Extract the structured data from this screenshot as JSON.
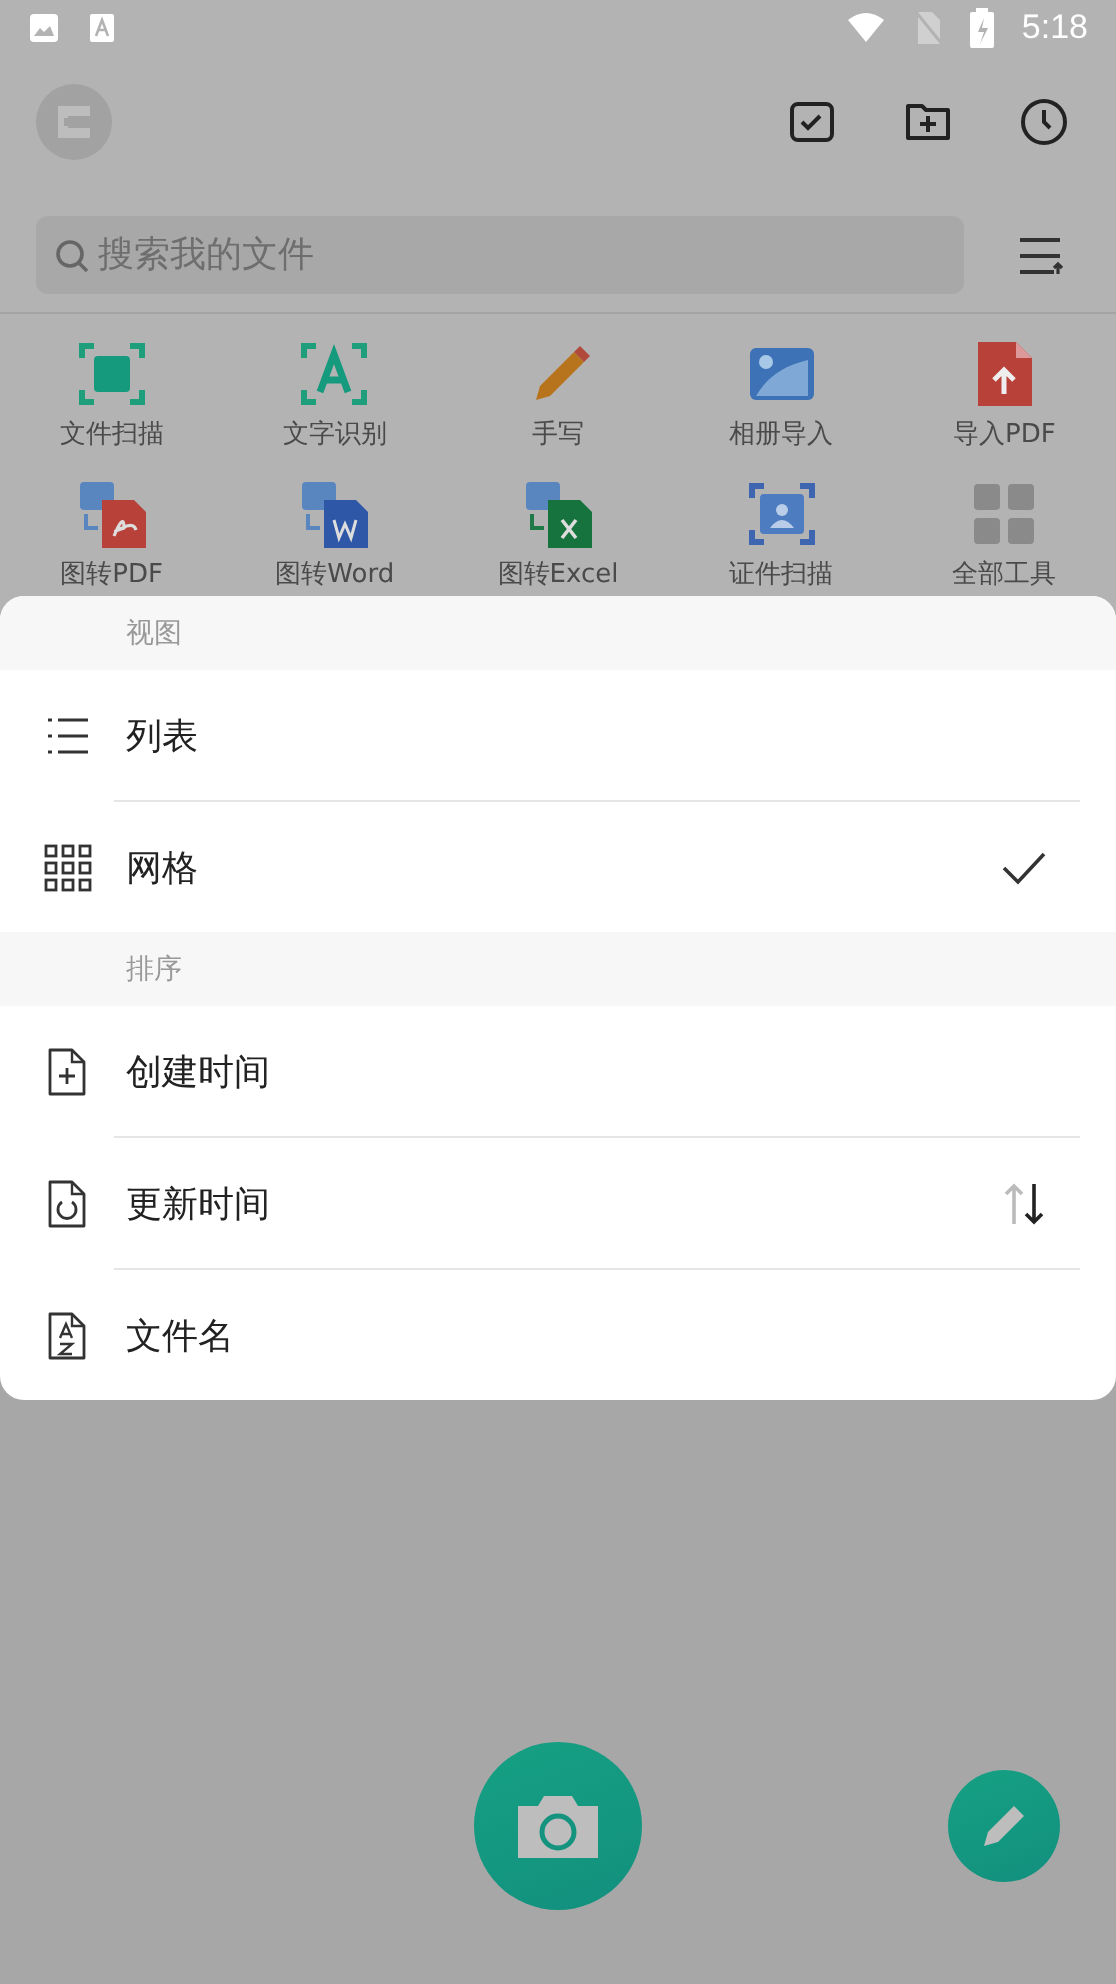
{
  "status_bar": {
    "time": "5:18"
  },
  "search": {
    "placeholder": "搜索我的文件"
  },
  "tools": [
    {
      "label": "文件扫描"
    },
    {
      "label": "文字识别"
    },
    {
      "label": "手写"
    },
    {
      "label": "相册导入"
    },
    {
      "label": "导入PDF"
    },
    {
      "label": "图转PDF"
    },
    {
      "label": "图转Word"
    },
    {
      "label": "图转Excel"
    },
    {
      "label": "证件扫描"
    },
    {
      "label": "全部工具"
    }
  ],
  "menu": {
    "view": {
      "title": "视图",
      "items": [
        {
          "label": "列表",
          "selected": false
        },
        {
          "label": "网格",
          "selected": true
        }
      ]
    },
    "sort": {
      "title": "排序",
      "descending": true,
      "items": [
        {
          "label": "创建时间",
          "selected": false
        },
        {
          "label": "更新时间",
          "selected": true
        },
        {
          "label": "文件名",
          "selected": false
        }
      ]
    }
  }
}
